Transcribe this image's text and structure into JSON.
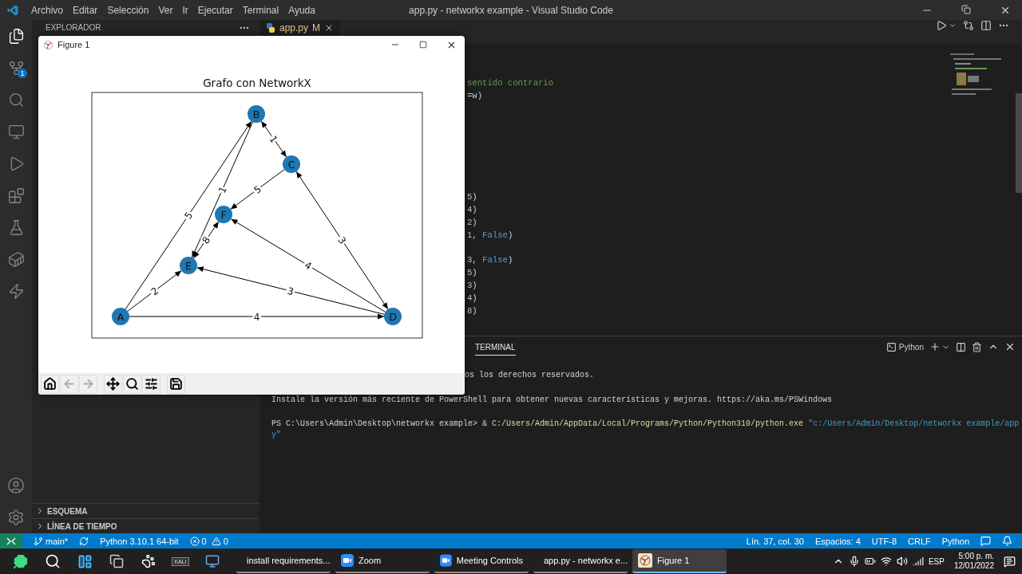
{
  "vscode": {
    "menu": [
      "Archivo",
      "Editar",
      "Selección",
      "Ver",
      "Ir",
      "Ejecutar",
      "Terminal",
      "Ayuda"
    ],
    "title": "app.py - networkx example - Visual Studio Code",
    "activity_bar": [
      {
        "kind": "explorer",
        "selected": true
      },
      {
        "kind": "source-control",
        "selected": false,
        "badge": "1"
      },
      {
        "kind": "search",
        "selected": false
      },
      {
        "kind": "remote",
        "selected": false
      },
      {
        "kind": "run",
        "selected": false
      },
      {
        "kind": "extensions",
        "selected": false
      },
      {
        "kind": "testing",
        "selected": false
      },
      {
        "kind": "docker",
        "selected": false
      },
      {
        "kind": "lightning",
        "selected": false
      }
    ],
    "activity_bar_bottom": [
      {
        "kind": "account"
      },
      {
        "kind": "settings"
      }
    ],
    "sidebar": {
      "title": "EXPLORADOR",
      "sections": [
        {
          "label": "ESQUEMA",
          "expanded": false
        },
        {
          "label": "LÍNEA DE TIEMPO",
          "expanded": false
        }
      ]
    },
    "editor_tab": {
      "label": "app.py",
      "status": "M"
    },
    "code_blocks": [
      {
        "lines": [
          {
            "segments": [
              {
                "kind": "comment",
                "text": "sentido contrario"
              }
            ]
          },
          {
            "segments": [
              {
                "kind": "plain",
                "text": "="
              },
              {
                "kind": "variable",
                "text": "w"
              },
              {
                "kind": "plain",
                "text": ")"
              }
            ]
          }
        ]
      },
      {
        "lines": [
          {
            "segments": [
              {
                "kind": "number",
                "text": "5"
              },
              {
                "kind": "plain",
                "text": ")"
              }
            ]
          },
          {
            "segments": [
              {
                "kind": "number",
                "text": "4"
              },
              {
                "kind": "plain",
                "text": ")"
              }
            ]
          },
          {
            "segments": [
              {
                "kind": "number",
                "text": "2"
              },
              {
                "kind": "plain",
                "text": ")"
              }
            ]
          },
          {
            "segments": [
              {
                "kind": "number",
                "text": "1"
              },
              {
                "kind": "plain",
                "text": ", "
              },
              {
                "kind": "keyword",
                "text": "False"
              },
              {
                "kind": "plain",
                "text": ")"
              }
            ]
          }
        ]
      },
      {
        "lines": [
          {
            "segments": [
              {
                "kind": "number",
                "text": "3"
              },
              {
                "kind": "plain",
                "text": ", "
              },
              {
                "kind": "keyword",
                "text": "False"
              },
              {
                "kind": "plain",
                "text": ")"
              }
            ]
          },
          {
            "segments": [
              {
                "kind": "number",
                "text": "5"
              },
              {
                "kind": "plain",
                "text": ")"
              }
            ]
          },
          {
            "segments": [
              {
                "kind": "number",
                "text": "3"
              },
              {
                "kind": "plain",
                "text": ")"
              }
            ]
          },
          {
            "segments": [
              {
                "kind": "number",
                "text": "4"
              },
              {
                "kind": "plain",
                "text": ")"
              }
            ]
          },
          {
            "segments": [
              {
                "kind": "number",
                "text": "8"
              },
              {
                "kind": "plain",
                "text": ")"
              }
            ]
          }
        ]
      }
    ],
    "panel": {
      "tabs": [
        {
          "label": "TERMINAL",
          "selected": true
        }
      ],
      "shell": "Python",
      "lines": [
        {
          "kind": "tail",
          "segments": [
            {
              "kind": "plain",
              "text": "os los derechos reservados."
            }
          ]
        },
        {
          "kind": "full",
          "segments": [
            {
              "kind": "plain",
              "text": "Instale la versión más reciente de PowerShell para obtener nuevas características y mejoras. https://aka.ms/PSWindows"
            }
          ]
        },
        {
          "kind": "full",
          "segments": [
            {
              "kind": "plain",
              "text": "PS C:\\Users\\Admin\\Desktop\\networkx example> & "
            },
            {
              "kind": "command",
              "text": "C:/Users/Admin/AppData/Local/Programs/Python/Python310/python.exe"
            },
            {
              "kind": "string",
              "text": " \"c:/Users/Admin/Desktop/networkx example/app"
            }
          ]
        },
        {
          "kind": "wrap",
          "segments": [
            {
              "kind": "string",
              "text": "y\""
            }
          ]
        }
      ]
    },
    "status_bar": {
      "branch": "main*",
      "interpreter": "Python 3.10.1 64-bit",
      "errors": "0",
      "warnings": "0",
      "right": [
        "Lín. 37, col. 30",
        "Espacios: 4",
        "UTF-8",
        "CRLF",
        "Python"
      ]
    }
  },
  "figure_window": {
    "title": "Figure 1",
    "plot_title": "Grafo con NetworkX",
    "nodes": [
      {
        "label": "A"
      },
      {
        "label": "B"
      },
      {
        "label": "C"
      },
      {
        "label": "D"
      },
      {
        "label": "E"
      },
      {
        "label": "F"
      }
    ],
    "edges": [
      {
        "label": "5",
        "bidirectional": false
      },
      {
        "label": "2",
        "bidirectional": false
      },
      {
        "label": "4",
        "bidirectional": false
      },
      {
        "label": "1",
        "bidirectional": true
      },
      {
        "label": "1",
        "bidirectional": false
      },
      {
        "label": "8",
        "bidirectional": true
      },
      {
        "label": "5",
        "bidirectional": false
      },
      {
        "label": "3",
        "bidirectional": true
      },
      {
        "label": "4",
        "bidirectional": false
      },
      {
        "label": "3",
        "bidirectional": false
      }
    ],
    "toolbar": [
      {
        "kind": "home",
        "disabled": false
      },
      {
        "kind": "back",
        "disabled": true
      },
      {
        "kind": "forward",
        "disabled": true
      },
      {
        "kind": "pan",
        "disabled": false
      },
      {
        "kind": "zoom",
        "disabled": false
      },
      {
        "kind": "configure",
        "disabled": false
      },
      {
        "kind": "save",
        "disabled": false
      }
    ]
  },
  "taskbar": {
    "pinned": [
      {
        "kind": "start"
      },
      {
        "kind": "search"
      },
      {
        "kind": "task-view"
      },
      {
        "kind": "windows"
      },
      {
        "kind": "paw"
      },
      {
        "kind": "kali",
        "label": "KALI"
      },
      {
        "kind": "computer"
      }
    ],
    "apps": [
      {
        "kind": "browser",
        "label": "install requirements...",
        "selected": false
      },
      {
        "kind": "zoom",
        "label": "Zoom",
        "selected": false
      },
      {
        "kind": "zoom",
        "label": "Meeting Controls",
        "selected": false
      },
      {
        "kind": "vscode",
        "label": "app.py - networkx e...",
        "selected": false
      },
      {
        "kind": "figure",
        "label": "Figure 1",
        "selected": true
      }
    ],
    "language": "ESP",
    "time": "5:00 p. m.",
    "date": "12/01/2022"
  }
}
